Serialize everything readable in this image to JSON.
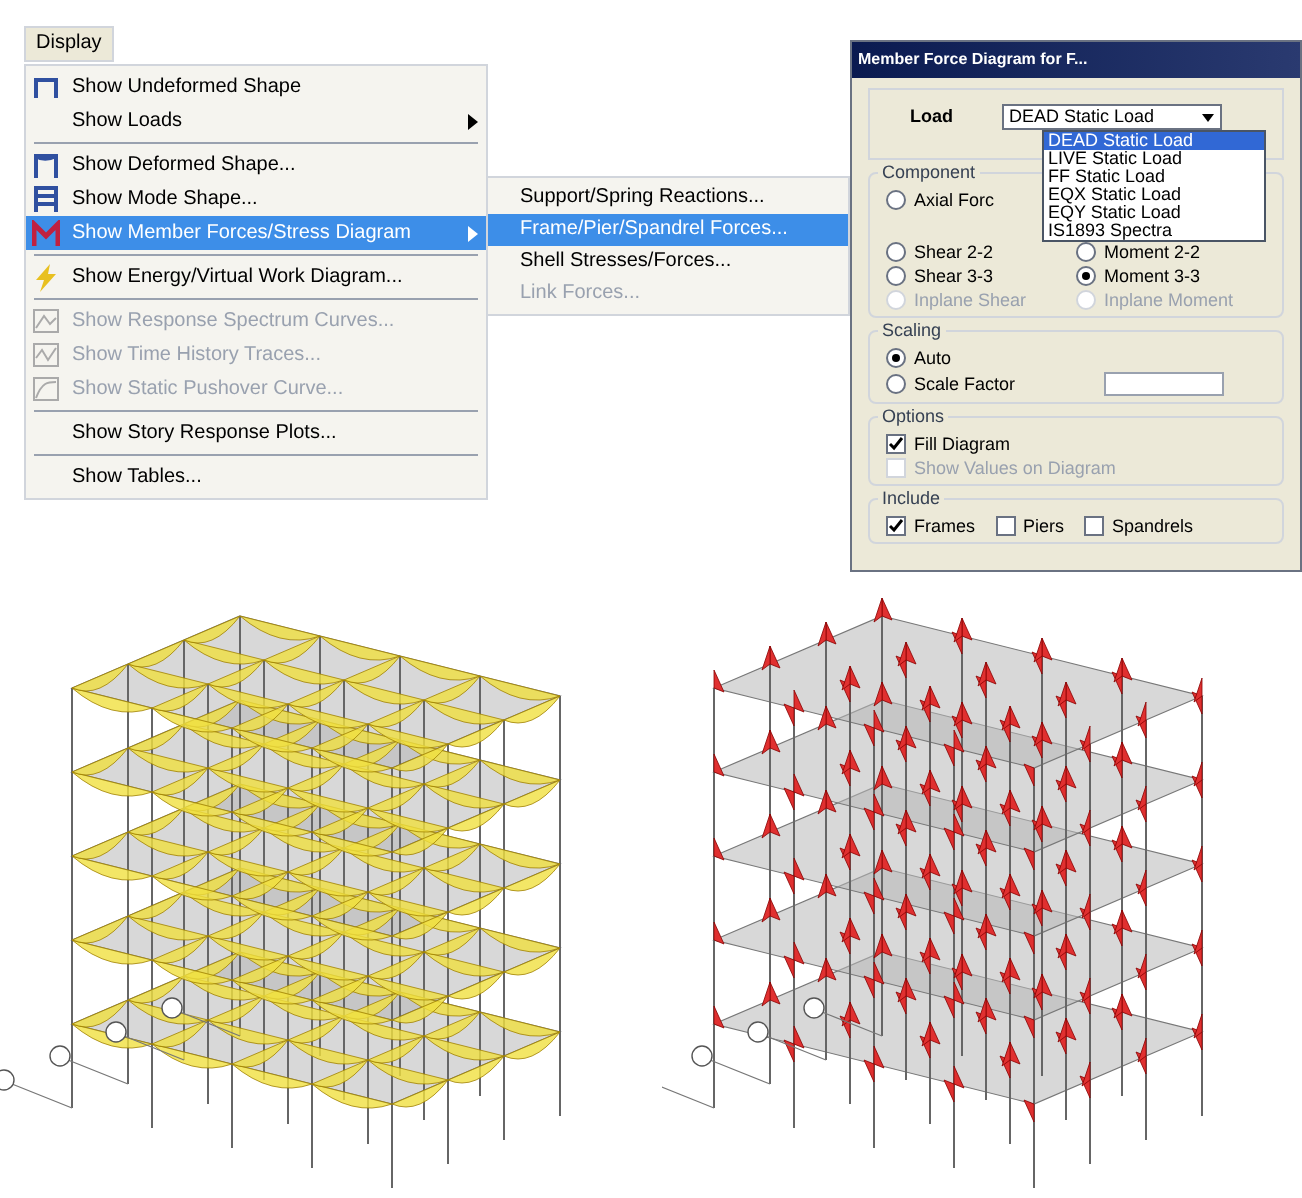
{
  "menu": {
    "title": "Display",
    "items": [
      {
        "kind": "item",
        "label": "Show Undeformed Shape",
        "selected": false,
        "disabled": false,
        "submenu": false
      },
      {
        "kind": "item",
        "label": "Show Loads",
        "selected": false,
        "disabled": false,
        "submenu": true
      },
      {
        "kind": "separator"
      },
      {
        "kind": "item",
        "label": "Show Deformed Shape...",
        "selected": false,
        "disabled": false,
        "submenu": false
      },
      {
        "kind": "item",
        "label": "Show Mode Shape...",
        "selected": false,
        "disabled": false,
        "submenu": false
      },
      {
        "kind": "item",
        "label": "Show Member Forces/Stress Diagram",
        "selected": true,
        "disabled": false,
        "submenu": true
      },
      {
        "kind": "separator"
      },
      {
        "kind": "item",
        "label": "Show Energy/Virtual Work Diagram...",
        "selected": false,
        "disabled": false,
        "submenu": false
      },
      {
        "kind": "separator"
      },
      {
        "kind": "item",
        "label": "Show Response Spectrum Curves...",
        "selected": false,
        "disabled": true,
        "submenu": false
      },
      {
        "kind": "item",
        "label": "Show Time History Traces...",
        "selected": false,
        "disabled": true,
        "submenu": false
      },
      {
        "kind": "item",
        "label": "Show Static Pushover Curve...",
        "selected": false,
        "disabled": true,
        "submenu": false
      },
      {
        "kind": "separator"
      },
      {
        "kind": "item",
        "label": "Show Story Response Plots...",
        "selected": false,
        "disabled": false,
        "submenu": false
      },
      {
        "kind": "separator"
      },
      {
        "kind": "item",
        "label": "Show Tables...",
        "selected": false,
        "disabled": false,
        "submenu": false
      }
    ]
  },
  "submenu": {
    "items": [
      {
        "label": "Support/Spring Reactions...",
        "selected": false,
        "disabled": false
      },
      {
        "label": "Frame/Pier/Spandrel Forces...",
        "selected": true,
        "disabled": false
      },
      {
        "label": "Shell Stresses/Forces...",
        "selected": false,
        "disabled": false
      },
      {
        "label": "Link Forces...",
        "selected": false,
        "disabled": true
      }
    ]
  },
  "dialog": {
    "title": "Member Force Diagram for F...",
    "load_label": "Load",
    "load_value": "DEAD Static Load",
    "load_options": [
      {
        "label": "DEAD Static Load",
        "selected": true
      },
      {
        "label": "LIVE Static Load",
        "selected": false
      },
      {
        "label": "FF Static Load",
        "selected": false
      },
      {
        "label": "EQX Static Load",
        "selected": false
      },
      {
        "label": "EQY Static Load",
        "selected": false
      },
      {
        "label": "IS1893 Spectra",
        "selected": false
      }
    ],
    "component": {
      "title": "Component",
      "options": [
        {
          "label": "Axial Forc",
          "selected": false,
          "disabled": false
        },
        {
          "label": "Shear 2-2",
          "selected": false,
          "disabled": false
        },
        {
          "label": "Moment 2-2",
          "selected": false,
          "disabled": false
        },
        {
          "label": "Shear 3-3",
          "selected": false,
          "disabled": false
        },
        {
          "label": "Moment 3-3",
          "selected": true,
          "disabled": false
        },
        {
          "label": "Inplane Shear",
          "selected": false,
          "disabled": true
        },
        {
          "label": "Inplane Moment",
          "selected": false,
          "disabled": true
        }
      ]
    },
    "scaling": {
      "title": "Scaling",
      "options": [
        {
          "label": "Auto",
          "selected": true
        },
        {
          "label": "Scale Factor",
          "selected": false
        }
      ]
    },
    "options": {
      "title": "Options",
      "items": [
        {
          "label": "Fill Diagram",
          "checked": true,
          "disabled": false
        },
        {
          "label": "Show Values on Diagram",
          "checked": false,
          "disabled": true
        }
      ]
    },
    "include": {
      "title": "Include",
      "items": [
        {
          "label": "Frames",
          "checked": true
        },
        {
          "label": "Piers",
          "checked": false
        },
        {
          "label": "Spandrels",
          "checked": false
        }
      ]
    }
  },
  "models": [
    {
      "kind": "moment-yellow"
    },
    {
      "kind": "moment-red"
    }
  ]
}
